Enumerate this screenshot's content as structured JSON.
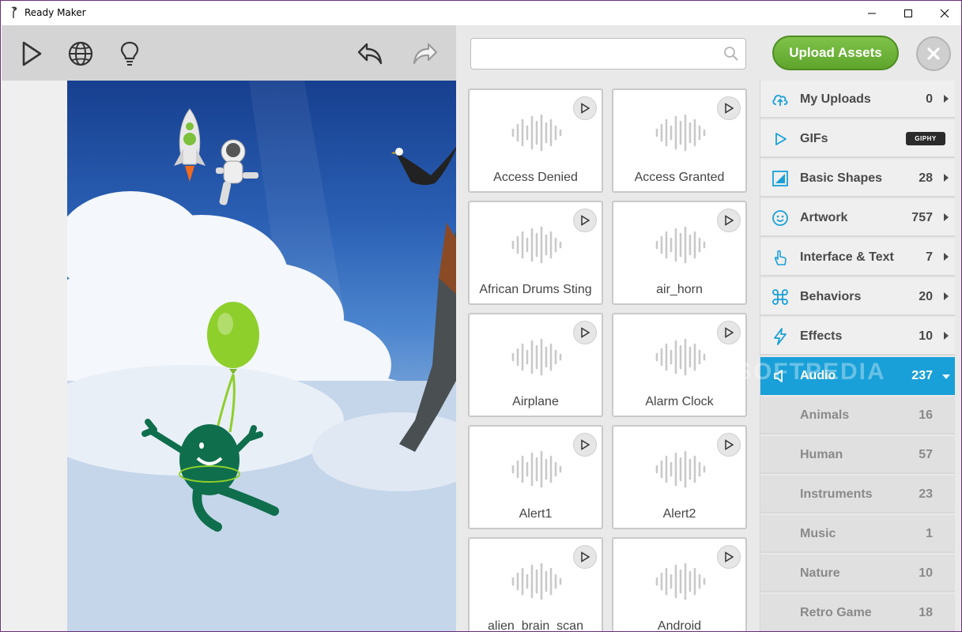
{
  "window": {
    "title": "Ready Maker"
  },
  "toolbar": {
    "play": "play-icon",
    "globe": "globe-icon",
    "hint": "lightbulb-icon",
    "undo": "undo-icon",
    "redo": "redo-icon"
  },
  "search": {
    "value": "",
    "placeholder": ""
  },
  "upload_button": "Upload Assets",
  "assets": [
    {
      "label": "Access Denied"
    },
    {
      "label": "Access Granted"
    },
    {
      "label": "African Drums Sting"
    },
    {
      "label": "air_horn"
    },
    {
      "label": "Airplane"
    },
    {
      "label": "Alarm Clock"
    },
    {
      "label": "Alert1"
    },
    {
      "label": "Alert2"
    },
    {
      "label": "alien_brain_scan"
    },
    {
      "label": "Android"
    }
  ],
  "categories": [
    {
      "name": "My Uploads",
      "count": "0",
      "icon": "cloud-upload-icon"
    },
    {
      "name": "GIFs",
      "count": "",
      "icon": "play-outline-icon",
      "badge": "GIPHY"
    },
    {
      "name": "Basic Shapes",
      "count": "28",
      "icon": "shapes-icon"
    },
    {
      "name": "Artwork",
      "count": "757",
      "icon": "smiley-icon"
    },
    {
      "name": "Interface & Text",
      "count": "7",
      "icon": "hand-pointer-icon"
    },
    {
      "name": "Behaviors",
      "count": "20",
      "icon": "command-icon"
    },
    {
      "name": "Effects",
      "count": "10",
      "icon": "lightning-icon"
    },
    {
      "name": "Audio",
      "count": "237",
      "icon": "speaker-icon"
    }
  ],
  "audio_subcategories": [
    {
      "name": "Animals",
      "count": "16"
    },
    {
      "name": "Human",
      "count": "57"
    },
    {
      "name": "Instruments",
      "count": "23"
    },
    {
      "name": "Music",
      "count": "1"
    },
    {
      "name": "Nature",
      "count": "10"
    },
    {
      "name": "Retro Game",
      "count": "18"
    }
  ],
  "watermark": "SOFTPEDIA",
  "colors": {
    "accent": "#1aa0d8",
    "upload_green": "#6db33f",
    "icon_blue": "#1aa0d8"
  }
}
